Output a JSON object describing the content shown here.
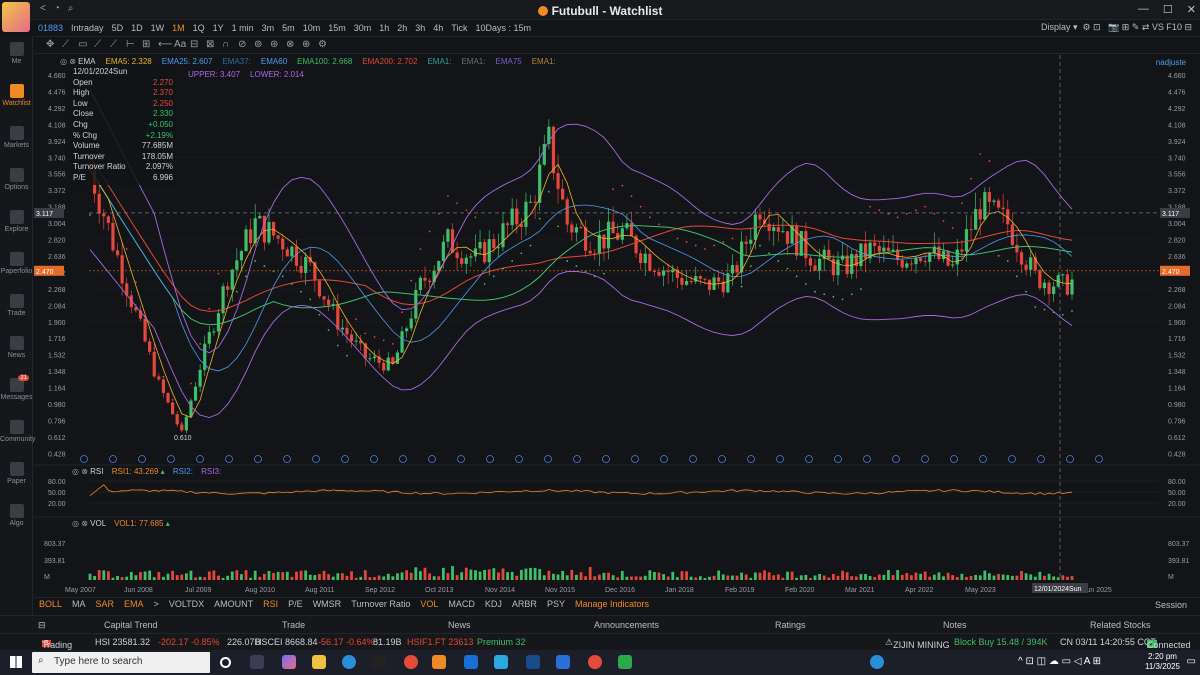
{
  "window": {
    "title": "Futubull - Watchlist",
    "min": "—",
    "max": "☐",
    "close": "✕"
  },
  "toolbar": {
    "ticker": "01883",
    "items": [
      "Intraday",
      "5D",
      "1D",
      "1W",
      "1M",
      "1Q",
      "1Y",
      "1 min",
      "3m",
      "5m",
      "10m",
      "15m",
      "30m",
      "1h",
      "2h",
      "3h",
      "4h",
      "Tick",
      "10Days : 15m"
    ],
    "active": "1M",
    "display": "Display"
  },
  "sidebar": {
    "items": [
      {
        "label": "Me"
      },
      {
        "label": "Watchlist",
        "active": true
      },
      {
        "label": "Markets"
      },
      {
        "label": "Options"
      },
      {
        "label": "Explore"
      },
      {
        "label": "Paperfolio"
      },
      {
        "label": "Trade"
      },
      {
        "label": "News"
      },
      {
        "label": "Messages",
        "badge": "21"
      },
      {
        "label": "Community"
      },
      {
        "label": "Paper"
      },
      {
        "label": "Algo"
      }
    ]
  },
  "indicators": {
    "ema_row": [
      {
        "t": "EMA",
        "c": "#cfd3da"
      },
      {
        "t": "EMA5: 2.328",
        "c": "#f0b429"
      },
      {
        "t": "EMA25: 2.607",
        "c": "#4d9ef0"
      },
      {
        "t": "EMA37:",
        "c": "#3a6a9a"
      },
      {
        "t": "EMA60",
        "c": "#4d9ef0"
      },
      {
        "t": "EMA100: 2.668",
        "c": "#3fbf6c"
      },
      {
        "t": "EMA200: 2.702",
        "c": "#e5473a"
      },
      {
        "t": "EMA1:",
        "c": "#2fa4a4"
      },
      {
        "t": "EMA1:",
        "c": "#6a6e75"
      },
      {
        "t": "EMA75",
        "c": "#7b5fd6"
      },
      {
        "t": "EMA1:",
        "c": "#b08a3a"
      }
    ],
    "boll_row": [
      {
        "t": "UPPER: 3.407",
        "c": "#a86be0"
      },
      {
        "t": "LOWER: 2.014",
        "c": "#a86be0"
      }
    ],
    "rsi": {
      "label": "RSI",
      "v1": "RSI1: 43.269",
      "v2": "RSI2:",
      "v3": "RSI3:"
    },
    "vol": {
      "label": "VOL",
      "v1": "VOL1: 77.685"
    }
  },
  "user": "nadjuste",
  "info": {
    "date": "12/01/2024Sun",
    "rows": [
      [
        "Open",
        "2.270",
        "#e5473a"
      ],
      [
        "High",
        "2.370",
        "#e5473a"
      ],
      [
        "Low",
        "2.250",
        "#e5473a"
      ],
      [
        "Close",
        "2.330",
        "#3fbf6c"
      ],
      [
        "Chg",
        "+0.050",
        "#3fbf6c"
      ],
      [
        "% Chg",
        "+2.19%",
        "#3fbf6c"
      ],
      [
        "Volume",
        "77.685M",
        "#cfd3da"
      ],
      [
        "Turnover",
        "178.05M",
        "#cfd3da"
      ],
      [
        "Turnover Ratio",
        "2.097%",
        "#cfd3da"
      ],
      [
        "P/E",
        "6.996",
        "#cfd3da"
      ]
    ]
  },
  "yaxis": [
    "4.660",
    "4.476",
    "4.292",
    "4.108",
    "3.924",
    "3.740",
    "3.556",
    "3.372",
    "3.188",
    "3.004",
    "2.820",
    "2.636",
    "2.452",
    "2.268",
    "2.084",
    "1.900",
    "1.716",
    "1.532",
    "1.348",
    "1.164",
    "0.980",
    "0.796",
    "0.612",
    "0.428"
  ],
  "price_markers": {
    "crosshair": "3.117",
    "last": "2.470",
    "low_label": "0.610"
  },
  "rsi_axis": [
    "80.00",
    "50.00",
    "20.00"
  ],
  "vol_axis": [
    "803.37",
    "393.81",
    "M"
  ],
  "xaxis": [
    "May 2007",
    "Jun 2008",
    "Jul 2009",
    "Aug 2010",
    "Aug 2011",
    "Sep 2012",
    "Oct 2013",
    "Nov 2014",
    "Nov 2015",
    "Dec 2016",
    "Jan 2018",
    "Feb 2019",
    "Feb 2020",
    "Mar 2021",
    "Apr 2022",
    "May 2023",
    "Jun 2025"
  ],
  "x_crosshair": "12/01/2024Sun",
  "indicator_tabs": {
    "items": [
      "BOLL",
      "MA",
      "SAR",
      "EMA",
      ">",
      "VOLTDX",
      "AMOUNT",
      "RSI",
      "P/E",
      "WMSR",
      "Turnover Ratio",
      "VOL",
      "MACD",
      "KDJ",
      "ARBR",
      "PSY",
      "Manage Indicators"
    ],
    "on": [
      "BOLL",
      "SAR",
      "EMA",
      "RSI",
      "VOL",
      "Manage Indicators"
    ],
    "session": "Session"
  },
  "bottom_nav": [
    "Capital Trend",
    "Trade",
    "News",
    "Announcements",
    "Ratings",
    "Notes",
    "Related Stocks"
  ],
  "status": {
    "trading": "Trading",
    "hsi": "HSI 23581.32",
    "hsi_chg": "-202.17  -0.85%",
    "hsi_amt": "226.07B",
    "hscei": "HSCEI 8668.84",
    "hscei_chg": "-56.17  -0.64%",
    "hscei_amt": "81.19B",
    "hsif": "HSIF1.FT 23613",
    "prem": "Premium 32",
    "stock": "ZIJIN MINING",
    "signal": "Block Buy 15.48 / 394K",
    "time": "CN 03/11 14:20:55 CCT",
    "conn": "Connected"
  },
  "taskbar": {
    "search": "Type here to search",
    "time": "2:20 pm",
    "date": "11/3/2025"
  },
  "colors": {
    "up": "#3fbf6c",
    "down": "#e5473a",
    "accent": "#f08a24",
    "bg": "#121417"
  }
}
